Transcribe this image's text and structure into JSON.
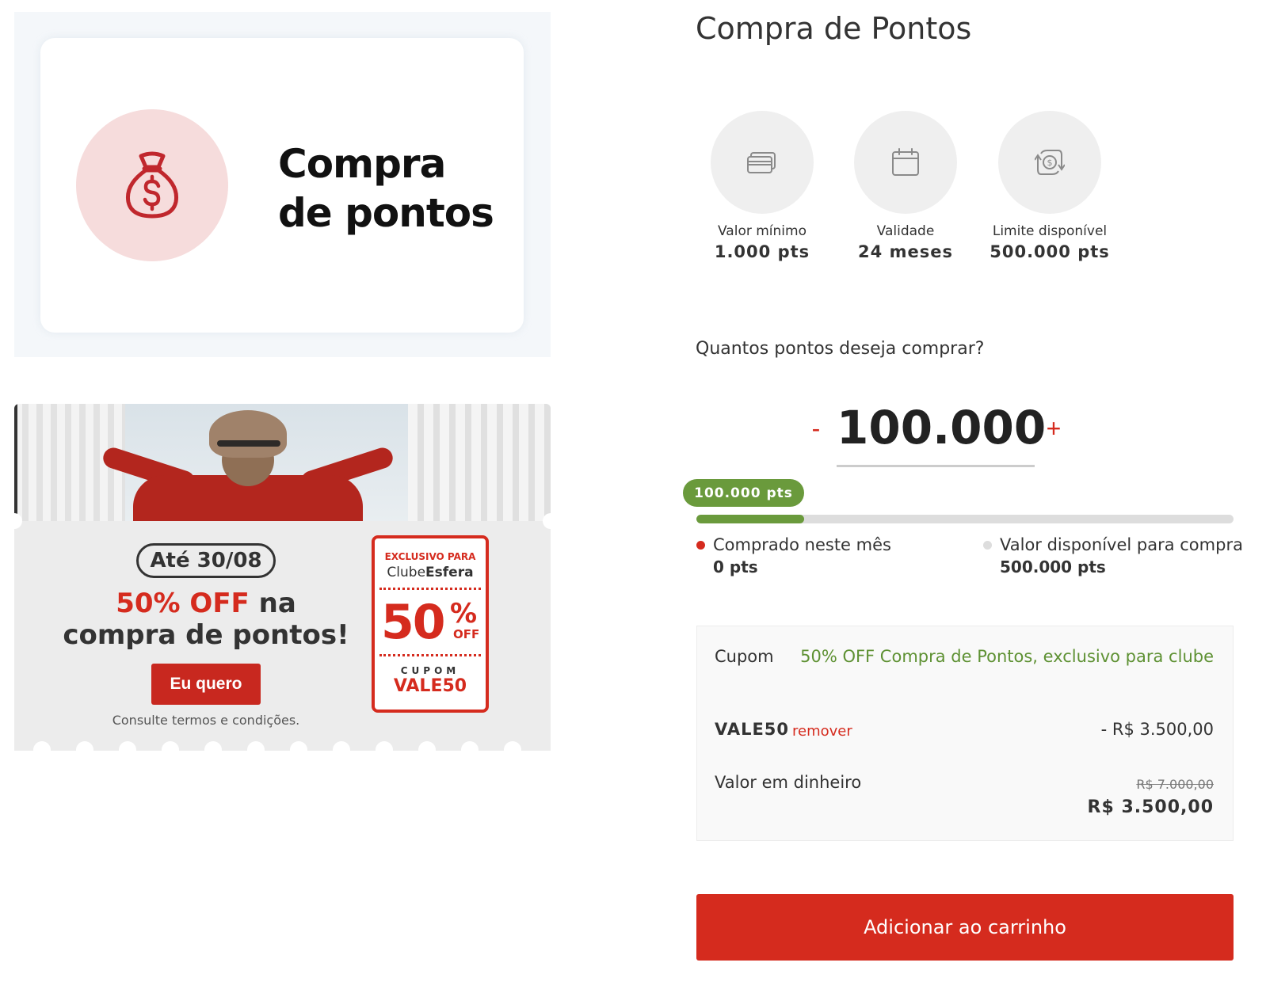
{
  "hero": {
    "title_line1": "Compra",
    "title_line2": "de pontos",
    "icon": "money-bag-icon",
    "accent_color": "#d52b1e"
  },
  "promo": {
    "until_label": "Até 30/08",
    "headline_red": "50% OFF",
    "headline_rest1": " na",
    "headline_rest2": "compra de pontos!",
    "cta_label": "Eu quero",
    "terms": "Consulte termos e condições.",
    "coupon_tag": {
      "exclusive": "EXCLUSIVO PARA",
      "brand_part1": "Clube",
      "brand_part2": "Esfera",
      "big_number": "50",
      "percent": "%",
      "off": "OFF",
      "coupon_word": "CUPOM",
      "code": "VALE50"
    }
  },
  "page": {
    "title": "Compra de Pontos"
  },
  "info": [
    {
      "icon": "credit-cards-icon",
      "label": "Valor mínimo",
      "value": "1.000 pts"
    },
    {
      "icon": "calendar-icon",
      "label": "Validade",
      "value": "24 meses"
    },
    {
      "icon": "exchange-coin-icon",
      "label": "Limite disponível",
      "value": "500.000 pts"
    }
  ],
  "purchase": {
    "question": "Quantos pontos deseja comprar?",
    "minus_label": "-",
    "plus_label": "+",
    "quantity": "100.000",
    "pill_label": "100.000 pts",
    "progress_fraction": 0.2,
    "progress_color": "#6a9a3c"
  },
  "legend": {
    "bought": {
      "label": "Comprado neste mês",
      "value": "0 pts",
      "color": "#d52b1e"
    },
    "available": {
      "label": "Valor disponível para compra",
      "value": "500.000 pts",
      "color": "#dddddd"
    }
  },
  "summary": {
    "coupon_label": "Cupom",
    "coupon_desc": "50% OFF Compra de Pontos, exclusivo para clube",
    "code": "VALE50",
    "remove_label": "remover",
    "discount": "- R$ 3.500,00",
    "cash_label": "Valor em dinheiro",
    "old_price": "R$ 7.000,00",
    "new_price": "R$ 3.500,00"
  },
  "cart": {
    "button_label": "Adicionar ao carrinho"
  }
}
